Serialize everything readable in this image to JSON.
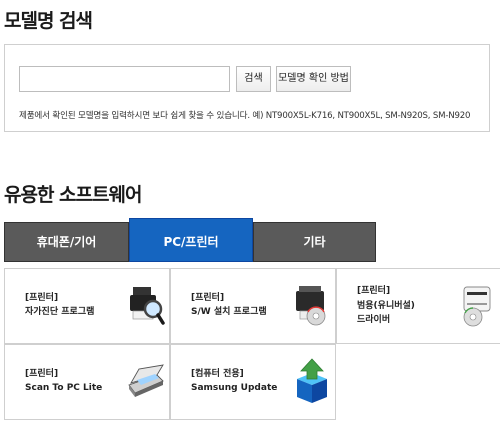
{
  "model_search": {
    "title": "모델명 검색",
    "input_value": "",
    "search_button": "검색",
    "howto_button": "모델명 확인 방법",
    "hint": "제품에서 확인된 모델명을 입력하시면 보다 쉽게 찾을 수 있습니다. 예) NT900X5L-K716, NT900X5L, SM-N920S, SM-N920"
  },
  "software": {
    "title": "유용한 소프트웨어",
    "tabs": [
      {
        "label": "휴대폰/기어",
        "active": false
      },
      {
        "label": "PC/프린터",
        "active": true
      },
      {
        "label": "기타",
        "active": false
      }
    ],
    "items": [
      {
        "lines": [
          "[프린터]",
          "자가진단 프로그램"
        ],
        "icon": "printer-diagnostic-icon"
      },
      {
        "lines": [
          "[프린터]",
          "S/W 설치 프로그램"
        ],
        "icon": "printer-software-install-icon"
      },
      {
        "lines": [
          "[프린터]",
          "범용(유니버설)",
          "드라이버"
        ],
        "icon": "printer-driver-disc-icon"
      },
      {
        "lines": [
          "[프린터]",
          "Scan To PC Lite"
        ],
        "icon": "scanner-icon"
      },
      {
        "lines": [
          "[컴퓨터 전용]",
          "Samsung Update"
        ],
        "icon": "samsung-update-box-icon"
      }
    ]
  },
  "colors": {
    "tab_active": "#1565c0",
    "tab_inactive": "#5a5a5a"
  }
}
